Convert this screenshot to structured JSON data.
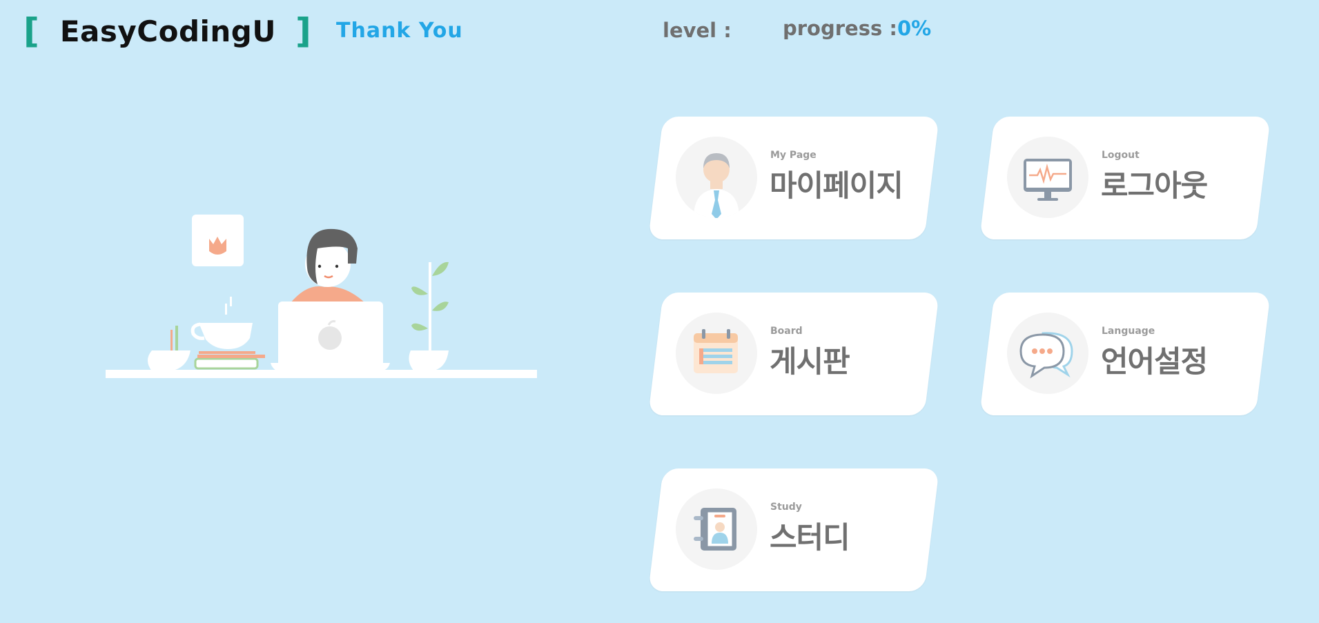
{
  "header": {
    "bracket_open": "[",
    "brand": "EasyCodingU",
    "bracket_close": "]",
    "nav_link": "Thank You",
    "level_label": "level :",
    "progress_label": "progress :",
    "progress_value": "0%"
  },
  "colors": {
    "background": "#cbeaf9",
    "bracket": "#1aa28a",
    "accent": "#22a6e6",
    "card": "#ffffff",
    "text_gray": "#707070"
  },
  "menu": [
    {
      "en": "My Page",
      "kr": "마이페이지",
      "icon": "doctor-avatar-icon"
    },
    {
      "en": "Logout",
      "kr": "로그아웃",
      "icon": "monitor-heartbeat-icon"
    },
    {
      "en": "Board",
      "kr": "게시판",
      "icon": "calendar-icon"
    },
    {
      "en": "Language",
      "kr": "언어설정",
      "icon": "chat-bubbles-icon"
    },
    {
      "en": "Study",
      "kr": "스터디",
      "icon": "id-notebook-icon"
    }
  ]
}
